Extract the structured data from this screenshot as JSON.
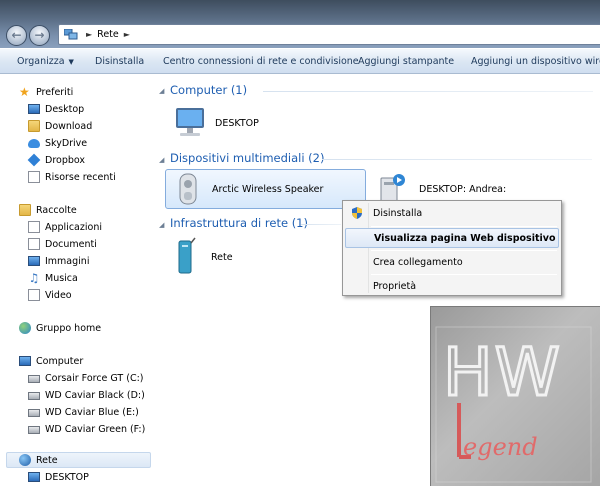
{
  "address": {
    "crumb": "Rete"
  },
  "toolbar": {
    "organize": "Organizza",
    "uninstall": "Disinstalla",
    "network_center": "Centro connessioni di rete e condivisione",
    "add_printer": "Aggiungi stampante",
    "add_device": "Aggiungi un dispositivo wirele"
  },
  "sidebar": {
    "favorites": {
      "label": "Preferiti",
      "items": [
        "Desktop",
        "Download",
        "SkyDrive",
        "Dropbox",
        "Risorse recenti"
      ]
    },
    "libraries": {
      "label": "Raccolte",
      "items": [
        "Applicazioni",
        "Documenti",
        "Immagini",
        "Musica",
        "Video"
      ]
    },
    "homegroup": {
      "label": "Gruppo home"
    },
    "computer": {
      "label": "Computer",
      "items": [
        "Corsair Force GT (C:)",
        "WD Caviar Black (D:)",
        "WD Caviar Blue (E:)",
        "WD Caviar Green (F:)"
      ]
    },
    "network": {
      "label": "Rete",
      "items": [
        "DESKTOP"
      ]
    }
  },
  "main": {
    "groups": [
      {
        "title": "Computer (1)",
        "items": [
          "DESKTOP"
        ]
      },
      {
        "title": "Dispositivi multimediali (2)",
        "items": [
          "Arctic Wireless Speaker",
          "DESKTOP: Andrea:"
        ]
      },
      {
        "title": "Infrastruttura di rete (1)",
        "items": [
          "Rete"
        ]
      }
    ]
  },
  "context_menu": {
    "items": [
      "Disinstalla",
      "Visualizza pagina Web dispositivo",
      "Crea collegamento",
      "Proprietà"
    ]
  },
  "watermark": {
    "text_top": "HW",
    "text_bottom": "Legend"
  },
  "colors": {
    "group_header": "#1e5eb1",
    "selection": "#d6e8fb",
    "toolbar": "#dae6f3"
  }
}
